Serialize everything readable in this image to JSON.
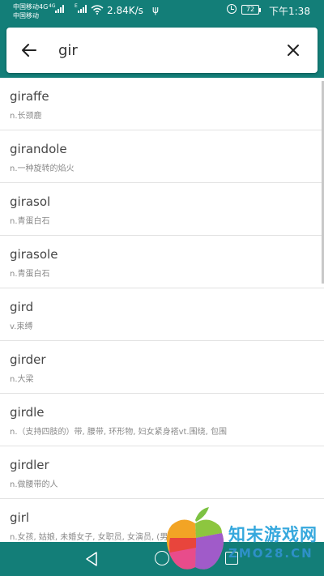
{
  "status_bar": {
    "carrier_1": "中国移动4G",
    "carrier_2": "中国移动",
    "net_tag_1": "4G",
    "net_tag_2": "E",
    "speed": "2.84K/s",
    "usb": "ψ",
    "battery": "72",
    "time": "下午1:38"
  },
  "search": {
    "query": "gir",
    "back_icon": "arrow-left-icon",
    "clear_icon": "close-icon"
  },
  "results": [
    {
      "word": "giraffe",
      "definition": "n.长颈鹿"
    },
    {
      "word": "girandole",
      "definition": "n.一种旋转的焰火"
    },
    {
      "word": "girasol",
      "definition": "n.青蛋白石"
    },
    {
      "word": "girasole",
      "definition": "n.青蛋白石"
    },
    {
      "word": "gird",
      "definition": "v.束缚"
    },
    {
      "word": "girder",
      "definition": "n.大梁"
    },
    {
      "word": "girdle",
      "definition": "n.（支持四肢的）带, 腰带, 环形物, 妇女紧身褡vt.围绕, 包围"
    },
    {
      "word": "girdler",
      "definition": "n.做腰带的人"
    },
    {
      "word": "girl",
      "definition": "n.女孩, 姑娘, 未婚女子, 女职员, 女演员, (男人的) 爱人"
    }
  ],
  "nav_bar": {
    "back_icon": "triangle-back-icon",
    "home_icon": "circle-home-icon",
    "recent_icon": "square-recent-icon"
  },
  "watermark": {
    "title": "知末游戏网",
    "site": "ZMO28.CN"
  },
  "colors": {
    "primary": "#137e78",
    "divider": "#e2e2e2",
    "word_text": "#454545",
    "definition_text": "#8a8a8a"
  }
}
